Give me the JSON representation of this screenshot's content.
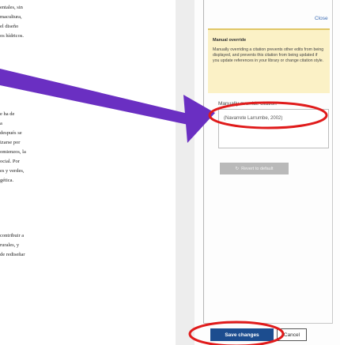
{
  "document": {
    "block1": [
      "entales, sin",
      "macultura,",
      "el diseño",
      "os hídricos."
    ],
    "block2": [
      "e ha de",
      "a",
      "después se",
      "izarse por",
      "omienzos, la",
      "ocial. Por",
      "es y verdes,",
      "gética."
    ],
    "block3": [
      "contribuir a",
      "rurales, y",
      "de rediseñar"
    ]
  },
  "panel": {
    "close_label": "Close",
    "override_title": "Manual override",
    "override_body": "Manually overriding a citation prevents other edits from being displayed, and prevents this citation from being updated if you update references in your library or change citation style.",
    "field_label": "Manually override citation",
    "field_value": "(Navarrete Larrumbe, 2002)",
    "reset_label": "Revert to default",
    "save_label": "Save changes",
    "cancel_label": "Cancel"
  },
  "annotation": {
    "arrow_color": "#6a2fc2",
    "circle_color": "#e01b1b"
  }
}
